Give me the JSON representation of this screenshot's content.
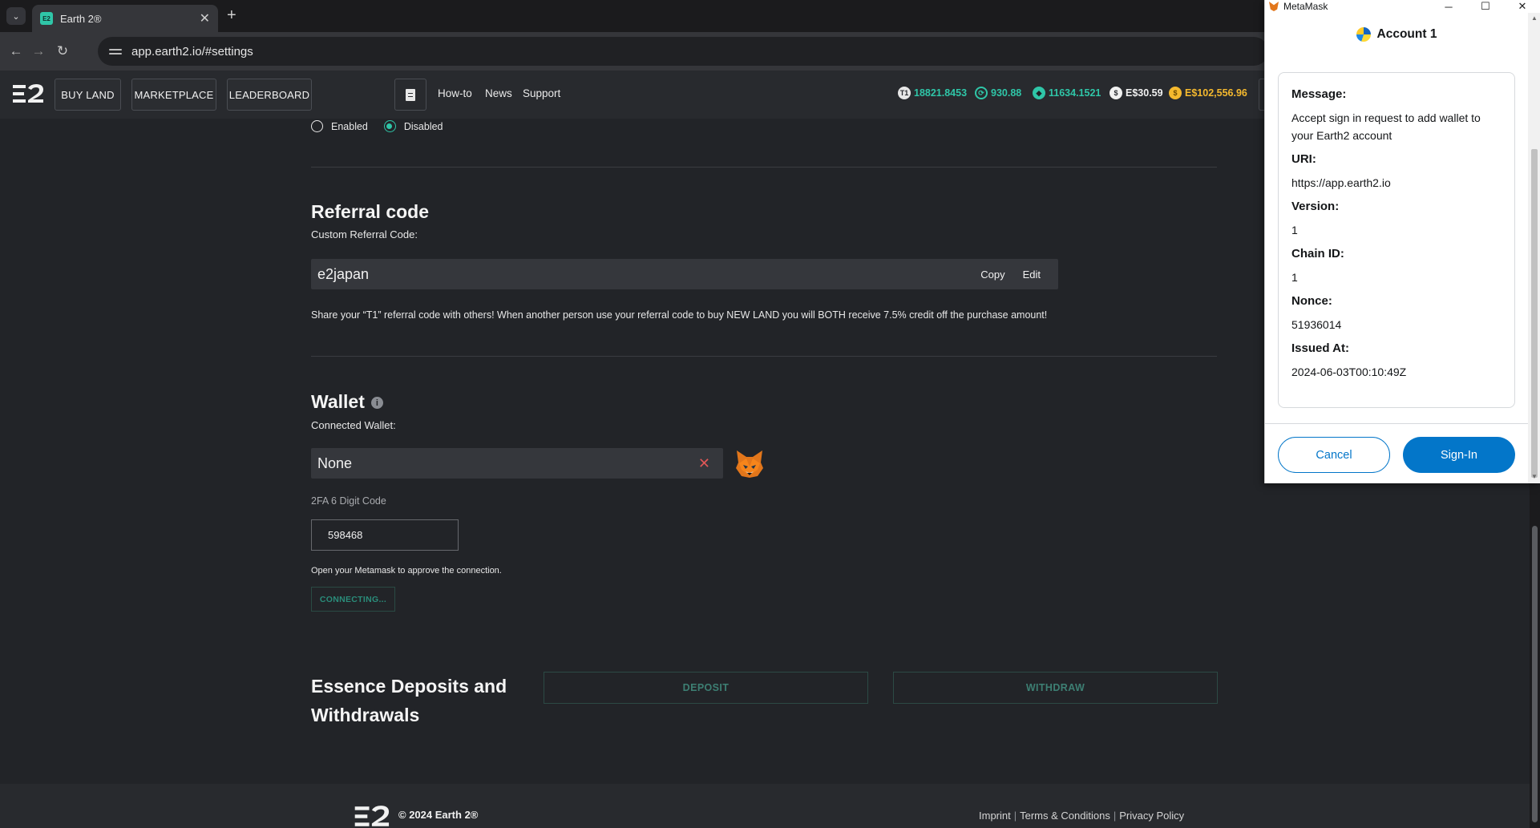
{
  "browser": {
    "tab_title": "Earth 2®",
    "tab_close": "✕",
    "new_tab": "+",
    "url": "app.earth2.io/#settings",
    "back": "←",
    "forward": "→",
    "reload": "↻"
  },
  "appbar": {
    "buy_land": "BUY LAND",
    "marketplace": "MARKETPLACE",
    "leaderboard": "LEADERBOARD",
    "links": [
      "How-to",
      "News",
      "Support"
    ],
    "balances": [
      {
        "icon": "tile-icon",
        "glyph": "T1",
        "value": "18821.8453",
        "color": "#2fc6a8"
      },
      {
        "icon": "essence-cycle-icon",
        "glyph": "⟳",
        "value": "930.88",
        "color": "#2fc6a8"
      },
      {
        "icon": "ether-icon",
        "glyph": "◆",
        "value": "11634.1521",
        "color": "#2fc6a8"
      },
      {
        "icon": "dollar-icon",
        "glyph": "$",
        "value": "E$30.59",
        "color": "#f1f1f1"
      },
      {
        "icon": "gold-coin-icon",
        "glyph": "$",
        "value": "E$102,556.96",
        "color": "#f5b92e"
      }
    ]
  },
  "settings": {
    "radio_enabled": "Enabled",
    "radio_disabled": "Disabled",
    "referral_title": "Referral code",
    "referral_label": "Custom Referral Code:",
    "referral_value": "e2japan",
    "copy": "Copy",
    "edit": "Edit",
    "referral_note": "Share your “T1” referral code with others! When another person use your referral code to buy NEW LAND you will BOTH receive 7.5% credit off the purchase amount!",
    "wallet_title": "Wallet",
    "wallet_label": "Connected Wallet:",
    "wallet_value": "None",
    "twofa_label": "2FA 6 Digit Code",
    "twofa_value": "598468",
    "metamask_note": "Open your Metamask to approve the connection.",
    "connecting": "CONNECTING...",
    "essence_title": "Essence Deposits and Withdrawals",
    "deposit": "DEPOSIT",
    "withdraw": "WITHDRAW"
  },
  "footer": {
    "copyright": "© 2024 Earth 2®",
    "imprint": "Imprint",
    "terms": "Terms & Conditions",
    "privacy": "Privacy Policy"
  },
  "metamask": {
    "window_title": "MetaMask",
    "account": "Account 1",
    "fields": [
      {
        "key": "Message:",
        "value": "Accept sign in request to add wallet to your Earth2 account"
      },
      {
        "key": "URI:",
        "value": "https://app.earth2.io"
      },
      {
        "key": "Version:",
        "value": "1"
      },
      {
        "key": "Chain ID:",
        "value": "1"
      },
      {
        "key": "Nonce:",
        "value": "51936014"
      },
      {
        "key": "Issued At:",
        "value": "2024-06-03T00:10:49Z"
      }
    ],
    "cancel": "Cancel",
    "sign_in": "Sign-In"
  }
}
